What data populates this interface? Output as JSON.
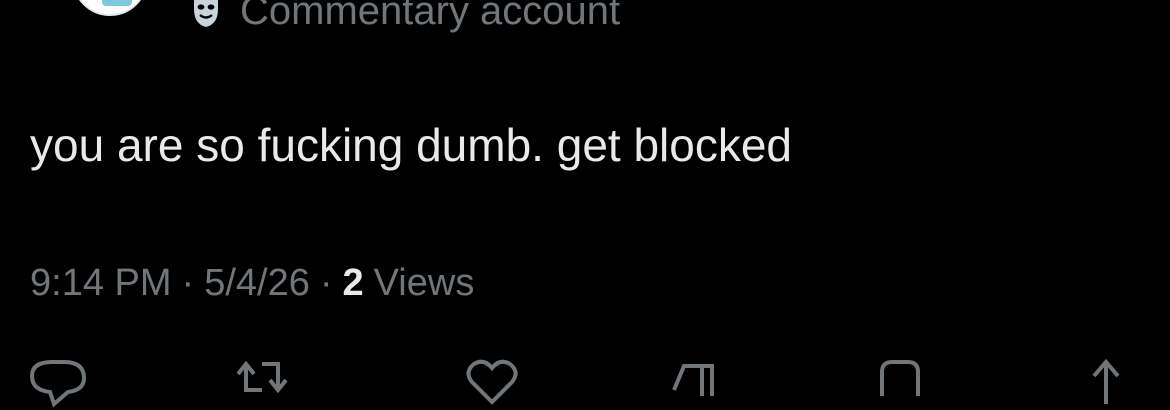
{
  "author": {
    "label": "Commentary account",
    "label_icon": "parody-mask-icon"
  },
  "tweet": {
    "text": "you are so fucking dumb. get blocked"
  },
  "meta": {
    "time": "9:14 PM",
    "separator": "·",
    "date": "5/4/26",
    "views_count": "2",
    "views_label": "Views"
  },
  "actions": [
    {
      "name": "reply-icon"
    },
    {
      "name": "retweet-icon"
    },
    {
      "name": "like-icon"
    },
    {
      "name": "bookmark-icon"
    },
    {
      "name": "share-icon"
    }
  ],
  "colors": {
    "background": "#000000",
    "primary_text": "#e7e9ea",
    "secondary_text": "#71767b",
    "avatar_accent": "#7cc9d9"
  }
}
